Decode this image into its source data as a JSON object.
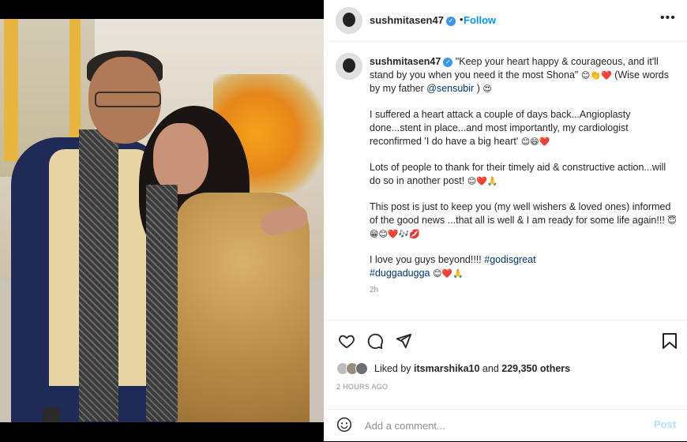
{
  "post": {
    "username": "sushmitasen47",
    "follow_label": "Follow",
    "more_label": "•••",
    "caption": {
      "quote": "\"Keep your heart happy & courageous, and it'll stand by you when you need it the most Shona\"",
      "quote_emoji": "😊👏❤️",
      "quote_after": "(Wise words by my father",
      "mention": "@sensubir",
      "quote_close": ")",
      "quote_close_emoji": "😍",
      "p2": "I suffered a heart attack a couple of days back...Angioplasty done...stent in place...and most importantly, my cardiologist reconfirmed 'I do have a big heart'",
      "p2_emoji": "😊😄❤️",
      "p3": "Lots of people to thank for their timely aid & constructive action...will do so in another post!",
      "p3_emoji": "😊❤️🙏",
      "p4": "This post is just to keep you (my well wishers & loved ones) informed of the good news ...that all is well & I am ready for some life again!!!",
      "p4_emoji": "😇😁😊❤️🎶💋",
      "p5": "I love you guys beyond!!!!",
      "hashtag1": "#godisgreat",
      "hashtag2": "#duggadugga",
      "p5_emoji": "😊❤️🙏",
      "time": "2h"
    },
    "likes": {
      "prefix": "Liked by",
      "user": "itsmarshika10",
      "middle": "and",
      "count": "229,350 others"
    },
    "posted": "2 HOURS AGO",
    "add_comment": {
      "placeholder": "Add a comment...",
      "post_label": "Post"
    }
  },
  "icons": [
    "heart-icon",
    "comment-icon",
    "share-icon",
    "save-icon",
    "emoji-icon",
    "verified-icon",
    "more-icon"
  ],
  "colors": {
    "link": "#0095f6",
    "hashtag": "#00376b",
    "muted": "#8e8e8e",
    "text": "#262626"
  }
}
